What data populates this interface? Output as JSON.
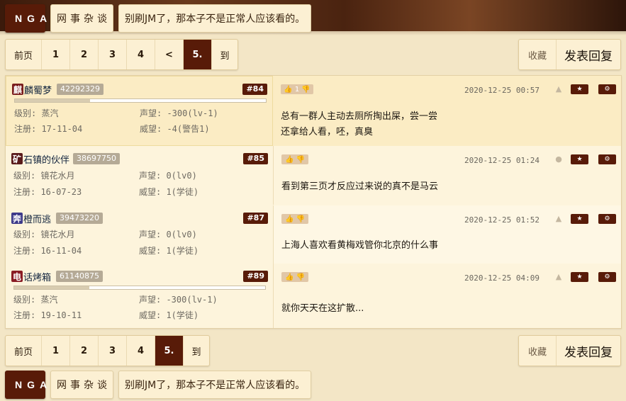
{
  "breadcrumb": {
    "site": "NGA",
    "forum": "网事杂谈",
    "thread": "别刷JM了，那本子不是正常人应该看的。"
  },
  "pager_top": {
    "first": "前页",
    "pages": [
      "1",
      "2",
      "3",
      "4",
      "<",
      "5."
    ],
    "go": "到"
  },
  "pager_bottom": {
    "first": "前页",
    "pages": [
      "1",
      "2",
      "3",
      "4",
      "5."
    ],
    "go": "到"
  },
  "actions": {
    "favorite": "收藏",
    "reply": "发表回复"
  },
  "posts": [
    {
      "avatar_char": "麒",
      "avatar_color": "#7a1d1d",
      "name_rest": "麟蜀梦",
      "uid": "42292329",
      "floor": "#84",
      "level_label": "级别: 蒸汽",
      "rep_label": "声望: -300(lv-1)",
      "reg_label": "注册: 17-11-04",
      "prestige_label": "威望: -4(警告1)",
      "rep_bar": 0.3,
      "like": "1",
      "time": "2020-12-25 00:57",
      "device": "android",
      "lines": [
        "总有一群人主动去厕所掏出屎，尝一尝",
        "还拿给人看，呸，真臭"
      ]
    },
    {
      "avatar_char": "矿",
      "avatar_color": "#5a1b1b",
      "name_rest": "石镇的伙伴",
      "uid": "38697750",
      "floor": "#85",
      "level_label": "级别: 镜花水月",
      "rep_label": "声望: 0(lv0)",
      "reg_label": "注册: 16-07-23",
      "prestige_label": "威望: 1(学徒)",
      "like": "",
      "time": "2020-12-25 01:24",
      "device": "apple",
      "lines": [
        "看到第三页才反应过来说的真不是马云"
      ]
    },
    {
      "avatar_char": "奔",
      "avatar_color": "#3d3a8a",
      "name_rest": "橙而逃",
      "uid": "39473220",
      "floor": "#87",
      "level_label": "级别: 镜花水月",
      "rep_label": "声望: 0(lv0)",
      "reg_label": "注册: 16-11-04",
      "prestige_label": "威望: 1(学徒)",
      "like": "",
      "time": "2020-12-25 01:52",
      "device": "android",
      "lines": [
        "上海人喜欢看黄梅戏管你北京的什么事"
      ]
    },
    {
      "avatar_char": "电",
      "avatar_color": "#8a1c24",
      "name_rest": "话烤箱",
      "uid": "61140875",
      "floor": "#89",
      "level_label": "级别: 蒸汽",
      "rep_label": "声望: -300(lv-1)",
      "reg_label": "注册: 19-10-11",
      "prestige_label": "威望: 1(学徒)",
      "rep_bar": 0.3,
      "like": "",
      "time": "2020-12-25 04:09",
      "device": "android",
      "lines": [
        "就你天天在这扩散..."
      ]
    }
  ]
}
